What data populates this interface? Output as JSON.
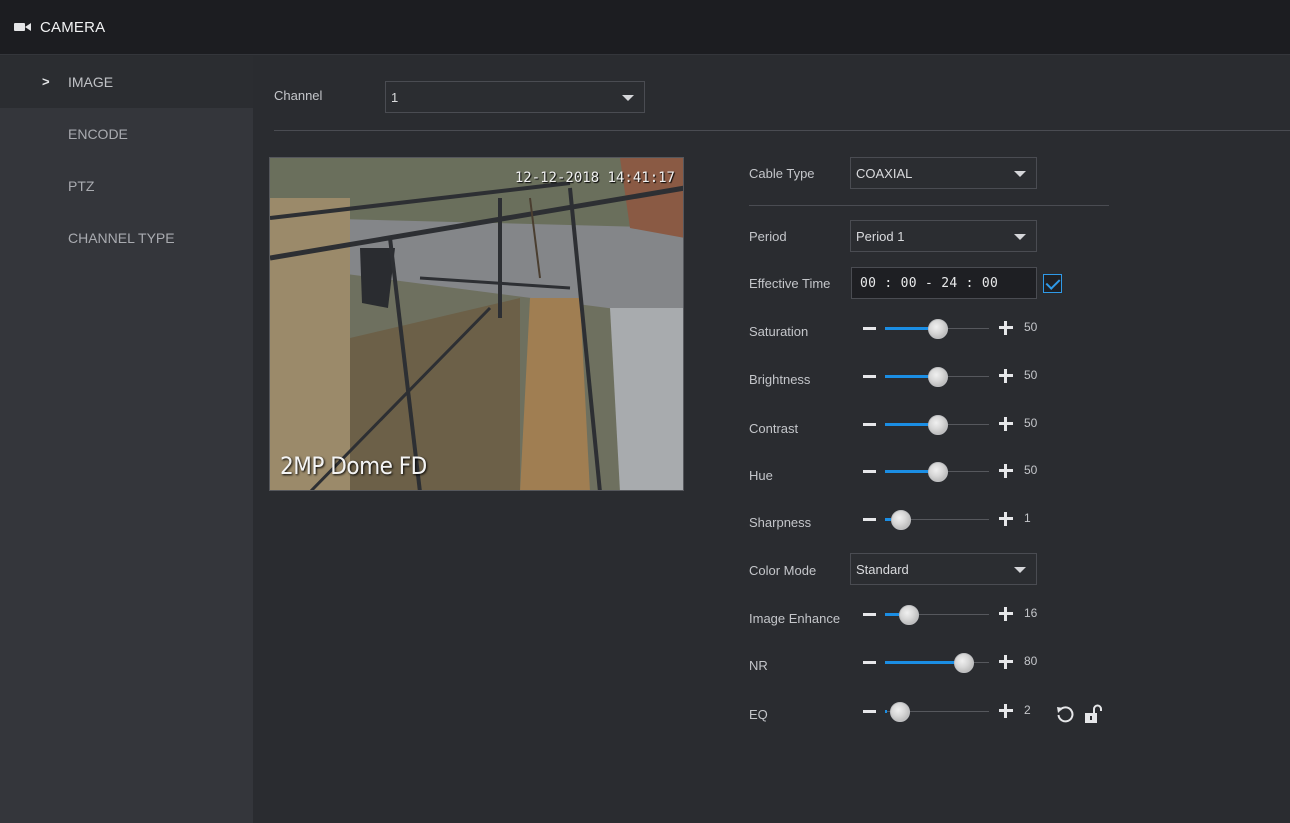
{
  "header": {
    "title": "CAMERA",
    "icon": "video-camera-icon"
  },
  "sidebar": {
    "items": [
      {
        "label": "IMAGE",
        "active": true
      },
      {
        "label": "ENCODE",
        "active": false
      },
      {
        "label": "PTZ",
        "active": false
      },
      {
        "label": "CHANNEL TYPE",
        "active": false
      }
    ]
  },
  "channel": {
    "label": "Channel",
    "value": "1"
  },
  "preview": {
    "overlay_name": "2MP Dome FD",
    "overlay_timestamp": "12-12-2018 14:41:17"
  },
  "settings": {
    "cable_type": {
      "label": "Cable Type",
      "value": "COAXIAL"
    },
    "period": {
      "label": "Period",
      "value": "Period 1"
    },
    "effective_time": {
      "label": "Effective Time",
      "value": "00 : 00 - 24 : 00",
      "enabled": true
    },
    "saturation": {
      "label": "Saturation",
      "value": "50"
    },
    "brightness": {
      "label": "Brightness",
      "value": "50"
    },
    "contrast": {
      "label": "Contrast",
      "value": "50"
    },
    "hue": {
      "label": "Hue",
      "value": "50"
    },
    "sharpness": {
      "label": "Sharpness",
      "value": "1"
    },
    "color_mode": {
      "label": "Color Mode",
      "value": "Standard"
    },
    "image_enhance": {
      "label": "Image Enhance",
      "value": "16"
    },
    "nr": {
      "label": "NR",
      "value": "80"
    },
    "eq": {
      "label": "EQ",
      "value": "2"
    }
  },
  "colors": {
    "accent": "#1b8ee4",
    "background": "#2a2c30",
    "sidebar": "#34363b",
    "topbar": "#1c1d21"
  },
  "icons": {
    "refresh": "refresh-icon",
    "lock": "unlock-icon"
  }
}
